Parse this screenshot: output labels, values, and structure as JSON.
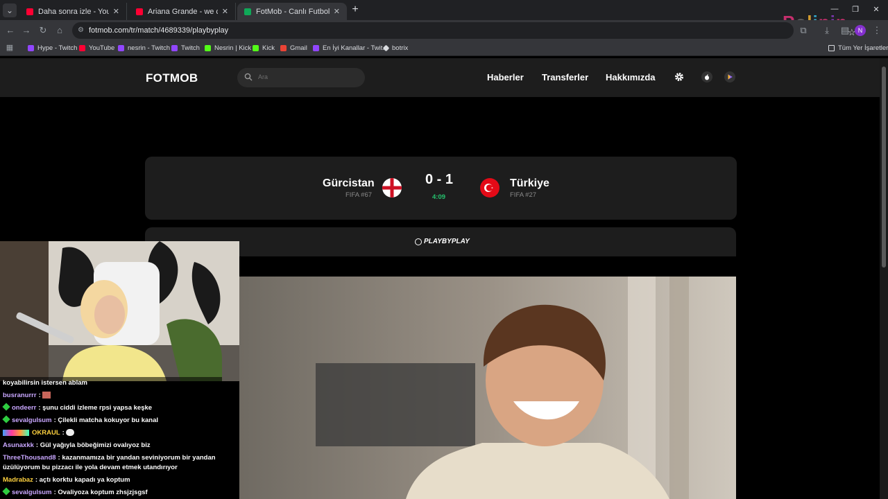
{
  "browser": {
    "tabs": [
      {
        "title": "Daha sonra izle - YouTube",
        "favicon": "youtube-icon"
      },
      {
        "title": "Ariana Grande - we can't be frie",
        "favicon": "youtube-icon"
      },
      {
        "title": "FotMob - Canlı Futbol Skorları",
        "favicon": "fotmob-icon",
        "active": true
      }
    ],
    "url": "fotmob.com/tr/match/4689339/playbyplay",
    "bookmarks": [
      {
        "label": "Hype - Twitch",
        "color": "#9146ff"
      },
      {
        "label": "YouTube",
        "color": "#ff0033"
      },
      {
        "label": "nesrin - Twitch",
        "color": "#9146ff"
      },
      {
        "label": "Twitch",
        "color": "#9146ff"
      },
      {
        "label": "Nesrin | Kick",
        "color": "#53fc18"
      },
      {
        "label": "Kick",
        "color": "#53fc18"
      },
      {
        "label": "Gmail",
        "color": "#ea4335"
      },
      {
        "label": "En İyi Kanallar - Twit...",
        "color": "#9146ff"
      },
      {
        "label": "botrix",
        "color": "#dadce0"
      }
    ],
    "all_bookmarks_label": "Tüm Yer İşaretleri"
  },
  "fotmob": {
    "logo": "FOTMOB",
    "search_placeholder": "Ara",
    "nav": [
      "Haberler",
      "Transferler",
      "Hakkımızda"
    ],
    "accent": "#25c26e"
  },
  "match": {
    "home": {
      "name": "Gürcistan",
      "rank": "FIFA #67",
      "flag": "england-flag-icon"
    },
    "away": {
      "name": "Türkiye",
      "rank": "FIFA #27",
      "flag": "turkey-flag-icon"
    },
    "score": "0 - 1",
    "clock": "4:09"
  },
  "playbyplay": {
    "logo": "PLAYBYPLAY"
  },
  "chat": [
    {
      "user": "",
      "text": "koyabilirsin istersen ablam",
      "user_color": "#ffffff"
    },
    {
      "user": "busranurrr",
      "text": ":",
      "user_color": "#c9a7ff"
    },
    {
      "user": "ondeerr",
      "text": ": şunu ciddi izleme rpsi yapsa keşke",
      "user_color": "#c9a7ff",
      "badge": true
    },
    {
      "user": "sevalgulsum",
      "text": ": Çilekli matcha kokuyor bu kanal",
      "user_color": "#c9a7ff",
      "badge": true
    },
    {
      "user": "OKRAUL",
      "text": ":",
      "user_color": "#ffd23f"
    },
    {
      "user": "Asunaxkk",
      "text": ": Gül yağıyla böbeğimizi ovalıyoz biz",
      "user_color": "#c9a7ff"
    },
    {
      "user": "ThreeThousand8",
      "text": ": kazanmamıza bir yandan seviniyorum bir yandan",
      "user_color": "#c9a7ff"
    },
    {
      "user": "",
      "text": "üzülüyorum bu pizzacı ile yola devam etmek utandırıyor",
      "user_color": "#ffffff"
    },
    {
      "user": "Madrabaz",
      "text": ": açtı korktu kapadı ya koptum",
      "user_color": "#ffd23f"
    },
    {
      "user": "sevalgulsum",
      "text": ": Ovaliyoza koptum zhsjzjsgsf",
      "user_color": "#c9a7ff",
      "badge": true
    }
  ]
}
